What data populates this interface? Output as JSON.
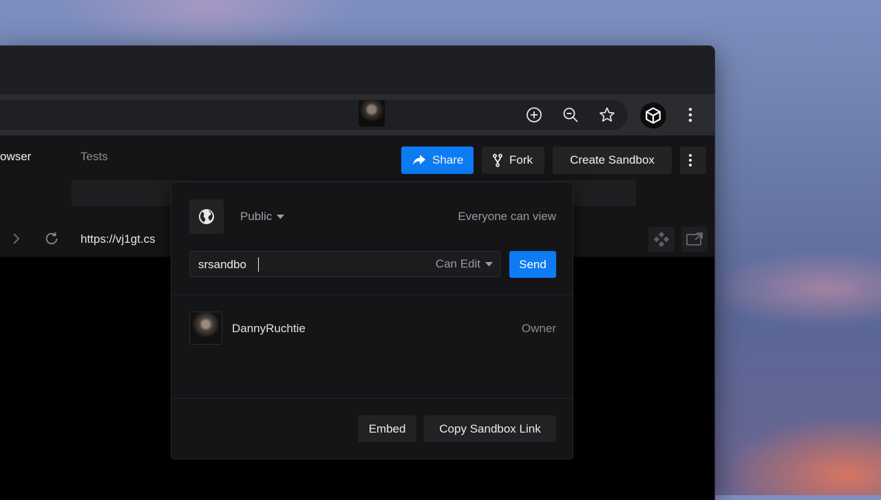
{
  "browser": {
    "toolbar_icons": [
      "add-circle-icon",
      "zoom-out-icon",
      "star-icon",
      "codesandbox-extension-icon",
      "more-vertical-icon"
    ]
  },
  "header": {
    "share_label": "Share",
    "fork_label": "Fork",
    "create_label": "Create Sandbox"
  },
  "preview_panel": {
    "tabs": [
      {
        "label": "owser"
      },
      {
        "label": "Tests"
      }
    ],
    "url": "https://vj1gt.cs"
  },
  "share_dialog": {
    "privacy_label": "Public",
    "privacy_description": "Everyone can view",
    "invite_value": "srsandbo",
    "permission_label": "Can Edit",
    "send_label": "Send",
    "members": [
      {
        "name": "DannyRuchtie",
        "role": "Owner"
      }
    ],
    "embed_label": "Embed",
    "copy_link_label": "Copy Sandbox Link"
  },
  "colors": {
    "accent": "#0d7bf2",
    "dialog_bg": "#151517",
    "text_primary": "#f2f2f2",
    "text_muted": "#9a9a9e"
  }
}
